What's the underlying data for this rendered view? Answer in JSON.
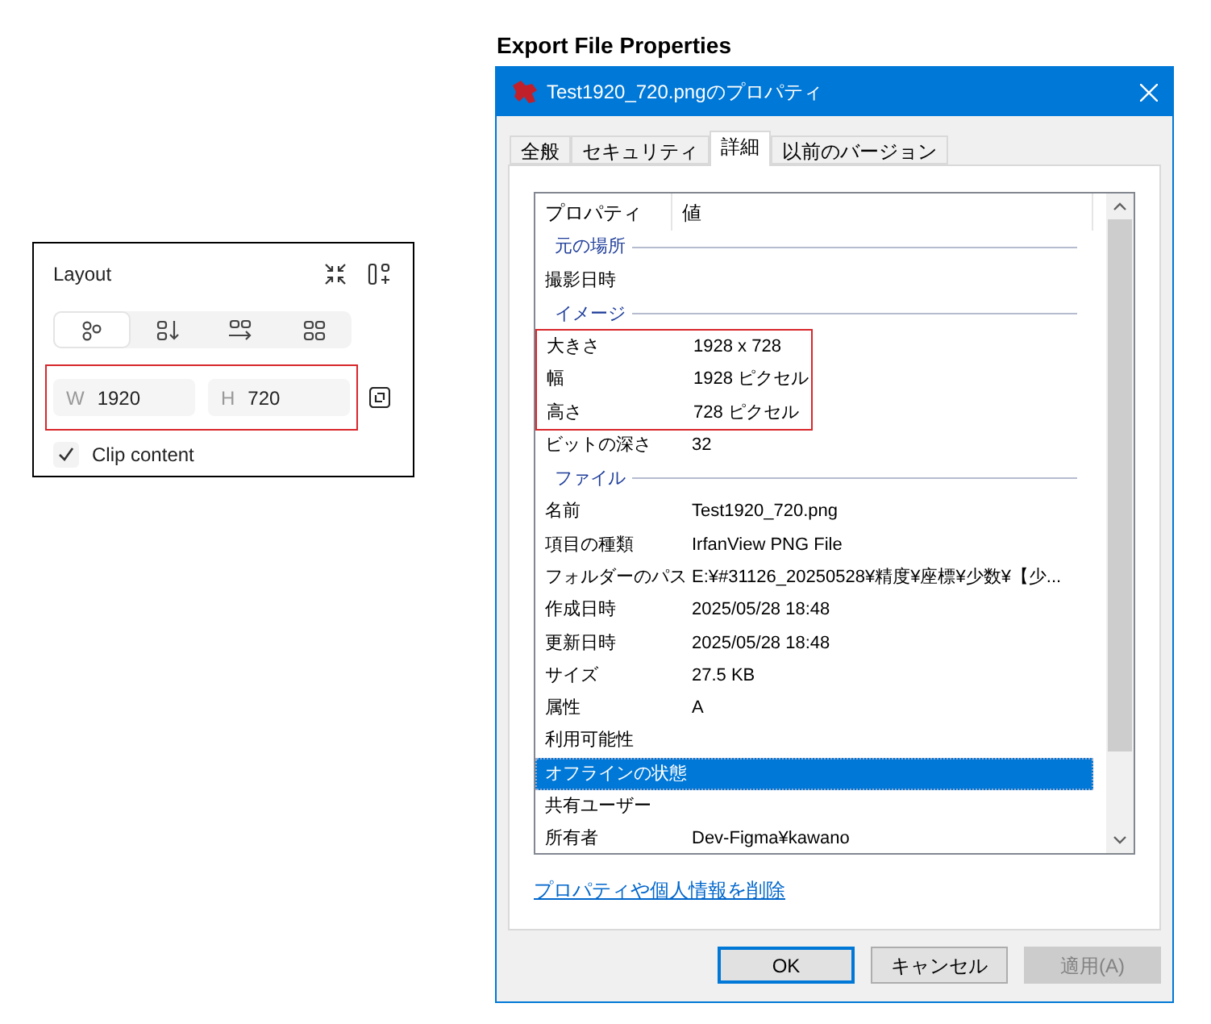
{
  "layout_panel": {
    "title": "Layout",
    "tabs": [
      {
        "kind": "freeform",
        "selected": true
      },
      {
        "kind": "vertical",
        "selected": false
      },
      {
        "kind": "horizontal",
        "selected": false
      },
      {
        "kind": "grid",
        "selected": false
      }
    ],
    "size_highlighted": true,
    "fields": [
      {
        "prefix": "W",
        "value": "1920"
      },
      {
        "prefix": "H",
        "value": "720"
      }
    ],
    "clip_content": {
      "label": "Clip content",
      "checked": true
    }
  },
  "heading": "Export File Properties",
  "dialog": {
    "title": "Test1920_720.pngのプロパティ",
    "tabs": [
      {
        "label": "全般",
        "selected": false
      },
      {
        "label": "セキュリティ",
        "selected": false
      },
      {
        "label": "詳細",
        "selected": true
      },
      {
        "label": "以前のバージョン",
        "selected": false
      }
    ],
    "columns": [
      "プロパティ",
      "値"
    ],
    "items": [
      {
        "kind": "section",
        "label": "元の場所"
      },
      {
        "kind": "row",
        "name": "撮影日時",
        "highlighted": false,
        "selected": false
      },
      {
        "kind": "section",
        "label": "イメージ"
      },
      {
        "kind": "row",
        "name": "大きさ",
        "value": "1928 x 728",
        "highlighted": true,
        "selected": false
      },
      {
        "kind": "row",
        "name": "幅",
        "value": "1928 ピクセル",
        "highlighted": true,
        "selected": false
      },
      {
        "kind": "row",
        "name": "高さ",
        "value": "728 ピクセル",
        "highlighted": true,
        "selected": false
      },
      {
        "kind": "row",
        "name": "ビットの深さ",
        "value": "32",
        "highlighted": false,
        "selected": false
      },
      {
        "kind": "section",
        "label": "ファイル"
      },
      {
        "kind": "row",
        "name": "名前",
        "value": "Test1920_720.png",
        "highlighted": false,
        "selected": false
      },
      {
        "kind": "row",
        "name": "項目の種類",
        "value": "IrfanView PNG File",
        "highlighted": false,
        "selected": false
      },
      {
        "kind": "row",
        "name": "フォルダーのパス",
        "value": "E:¥#31126_20250528¥精度¥座標¥少数¥【少...",
        "highlighted": false,
        "selected": false
      },
      {
        "kind": "row",
        "name": "作成日時",
        "value": "2025/05/28 18:48",
        "highlighted": false,
        "selected": false
      },
      {
        "kind": "row",
        "name": "更新日時",
        "value": "2025/05/28 18:48",
        "highlighted": false,
        "selected": false
      },
      {
        "kind": "row",
        "name": "サイズ",
        "value": "27.5 KB",
        "highlighted": false,
        "selected": false
      },
      {
        "kind": "row",
        "name": "属性",
        "value": "A",
        "highlighted": false,
        "selected": false
      },
      {
        "kind": "row",
        "name": "利用可能性",
        "highlighted": false,
        "selected": false
      },
      {
        "kind": "row",
        "name": "オフラインの状態",
        "highlighted": false,
        "selected": true
      },
      {
        "kind": "row",
        "name": "共有ユーザー",
        "highlighted": false,
        "selected": false
      },
      {
        "kind": "row",
        "name": "所有者",
        "value": "Dev-Figma¥kawano",
        "highlighted": false,
        "selected": false
      }
    ],
    "link": "プロパティや個人情報を削除",
    "buttons": [
      {
        "label": "OK",
        "kind": "default",
        "disabled": false
      },
      {
        "label": "キャンセル",
        "kind": "normal",
        "disabled": false
      },
      {
        "label": "適用(A)",
        "kind": "normal",
        "disabled": true
      }
    ]
  }
}
